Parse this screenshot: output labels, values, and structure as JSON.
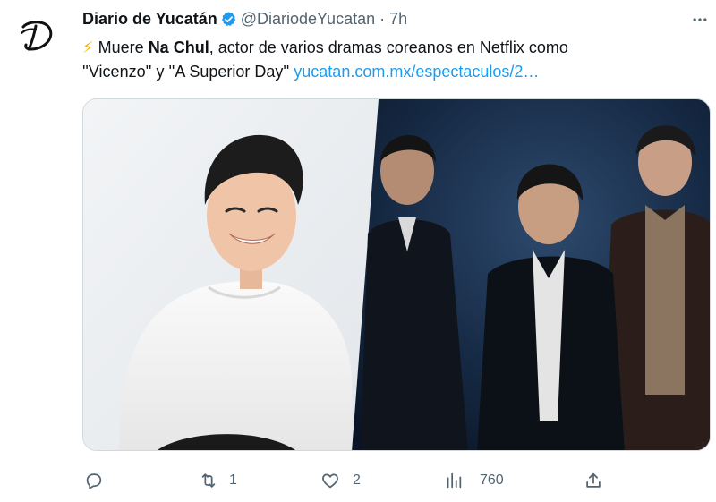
{
  "tweet": {
    "author": {
      "display_name": "Diario de Yucatán",
      "handle": "@DiariodeYucatan",
      "verified": true,
      "avatar_letter": "D"
    },
    "timestamp": "7h",
    "separator": "·",
    "text": {
      "emoji": "⚡",
      "part1": "Muere ",
      "bold": "Na Chul",
      "part2": ", actor de varios dramas coreanos en Netflix como",
      "line2": "''Vicenzo'' y ''A Superior Day'' ",
      "link": "yucatan.com.mx/espectaculos/2…"
    },
    "media": {
      "left_description": "smiling man in white sweater",
      "right_description": "three men in dark suits"
    }
  },
  "actions": {
    "reply": {
      "icon": "reply-icon",
      "count": ""
    },
    "retweet": {
      "icon": "retweet-icon",
      "count": "1"
    },
    "like": {
      "icon": "like-icon",
      "count": "2"
    },
    "views": {
      "icon": "views-icon",
      "count": "760"
    },
    "share": {
      "icon": "share-icon",
      "count": ""
    }
  },
  "colors": {
    "text": "#0f1419",
    "secondary": "#536471",
    "link": "#1d9bf0",
    "verified": "#1d9bf0"
  }
}
